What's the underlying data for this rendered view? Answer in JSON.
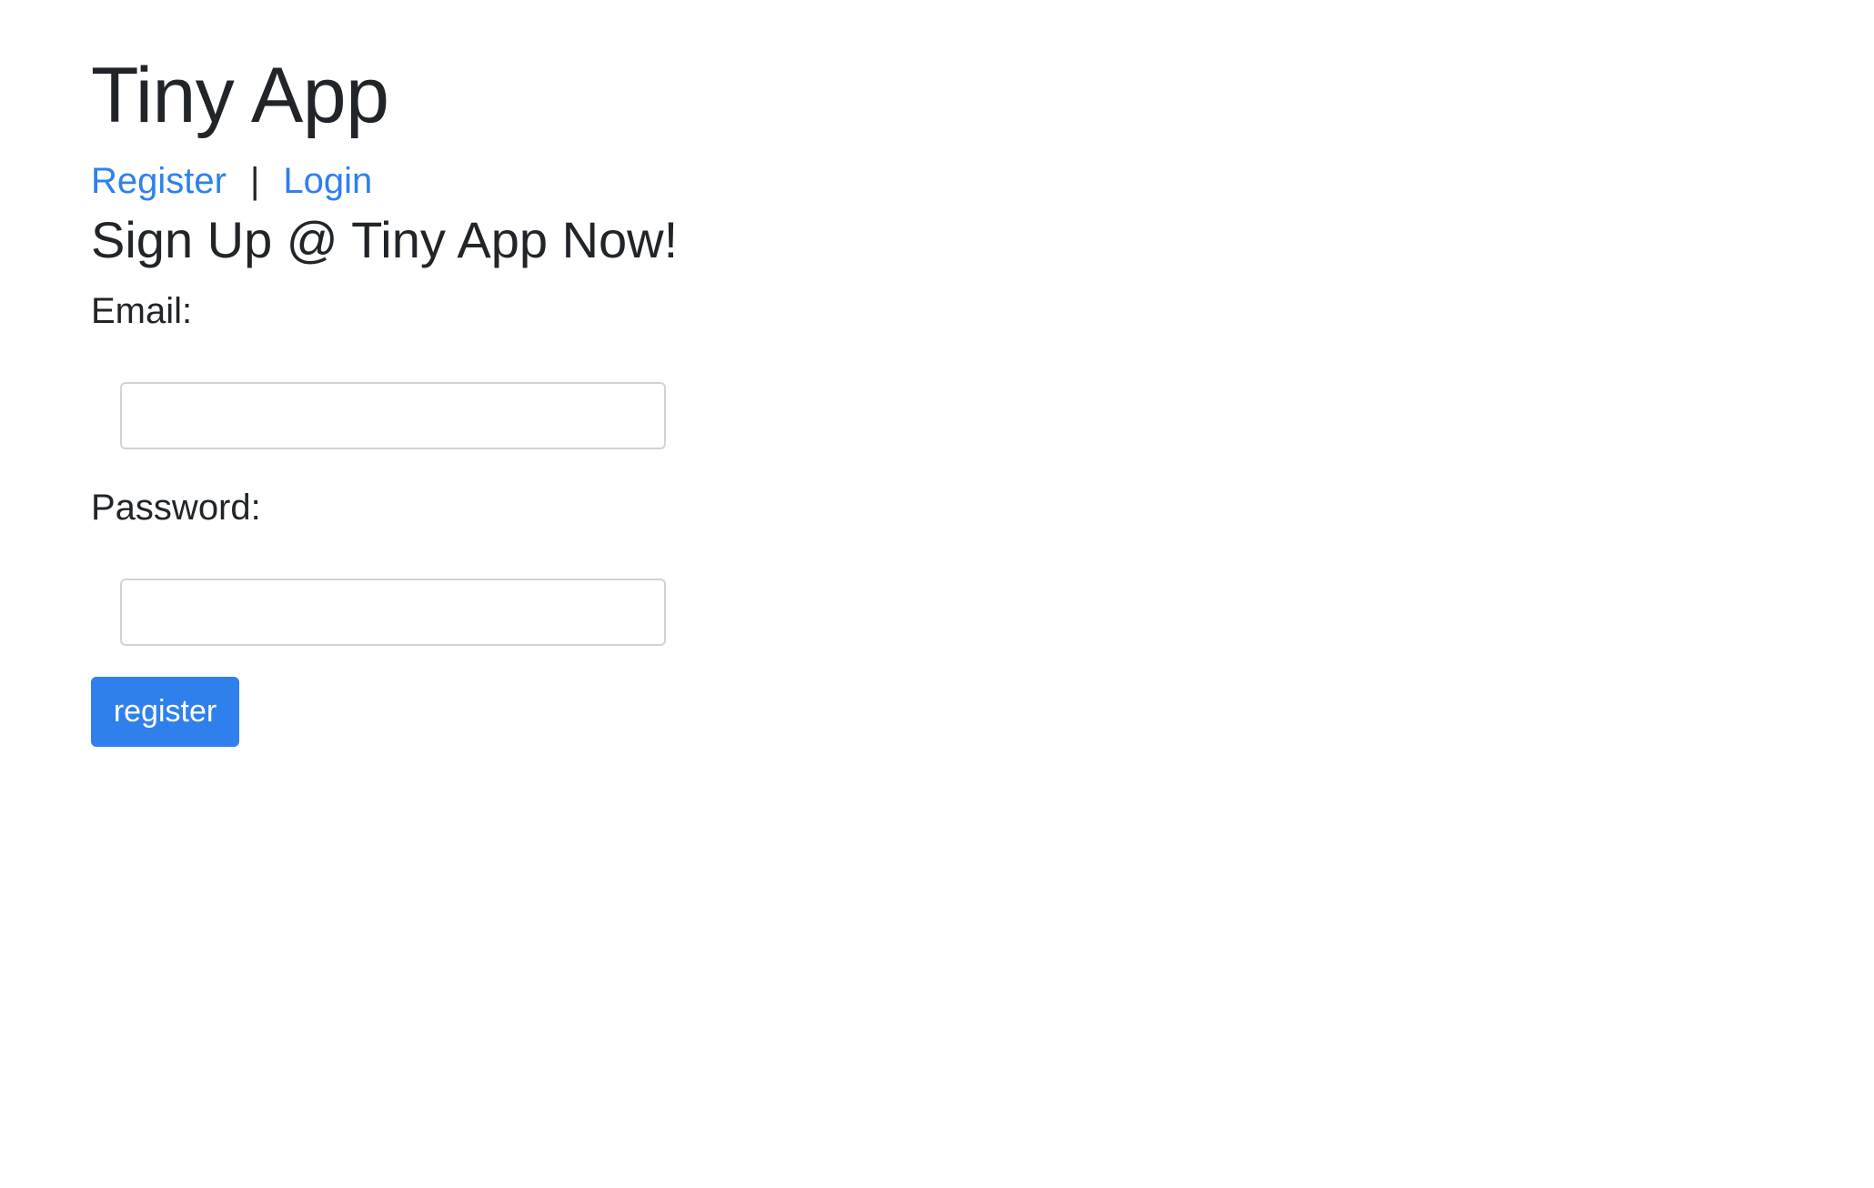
{
  "app": {
    "title": "Tiny App"
  },
  "nav": {
    "register_label": "Register",
    "separator": "|",
    "login_label": "Login"
  },
  "form": {
    "heading": "Sign Up @ Tiny App Now!",
    "email": {
      "label": "Email:",
      "value": "",
      "placeholder": ""
    },
    "password": {
      "label": "Password:",
      "value": "",
      "placeholder": ""
    },
    "submit_label": "register"
  },
  "colors": {
    "link": "#2f80ed",
    "button_bg": "#2f80ed",
    "button_text": "#ffffff",
    "text": "#212529",
    "input_border": "#ced4da"
  }
}
